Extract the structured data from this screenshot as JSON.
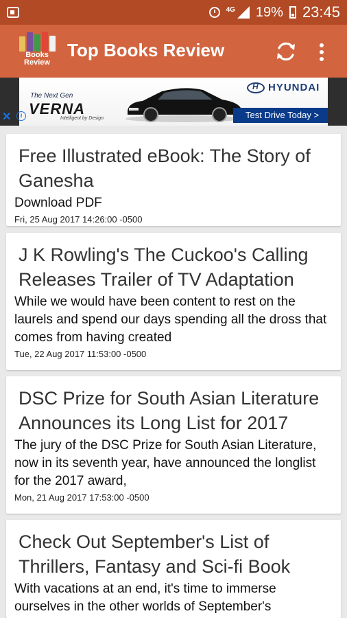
{
  "status_bar": {
    "network": "4G",
    "battery": "19%",
    "time": "23:45"
  },
  "app_bar": {
    "logo_text_1": "Books",
    "logo_text_2": "Review",
    "title": "Top Books Review",
    "icons": [
      "refresh-icon",
      "more-vert-icon"
    ]
  },
  "ad": {
    "tagline": "The Next Gen",
    "model": "VERNA",
    "sub": "Intelligent by Design",
    "brand": "HYUNDAI",
    "cta": "Test Drive Today >"
  },
  "articles": [
    {
      "title": "Free Illustrated eBook: The Story of Ganesha",
      "description": "Download PDF",
      "date": "Fri, 25 Aug 2017 14:26:00 -0500"
    },
    {
      "title": "J K Rowling's The Cuckoo's Calling Releases Trailer of TV Adaptation",
      "description": "While we would have been content to rest on the laurels and spend our days spending all the dross that comes from having created",
      "date": "Tue, 22 Aug 2017 11:53:00 -0500"
    },
    {
      "title": "DSC Prize for South Asian Literature Announces its Long List for 2017",
      "description": "The jury of the DSC Prize for South Asian Literature, now in its seventh year, have announced the longlist for the 2017 award,",
      "date": "Mon, 21 Aug 2017 17:53:00 -0500"
    },
    {
      "title": "Check Out September's List of Thrillers, Fantasy and Sci-fi Book",
      "description": "With vacations at an end, it's time to immerse ourselves in the other worlds of September's",
      "date": ""
    }
  ],
  "colors": {
    "status_bar": "#b24a26",
    "app_bar": "#d2643f",
    "background": "#e9e9e9"
  }
}
